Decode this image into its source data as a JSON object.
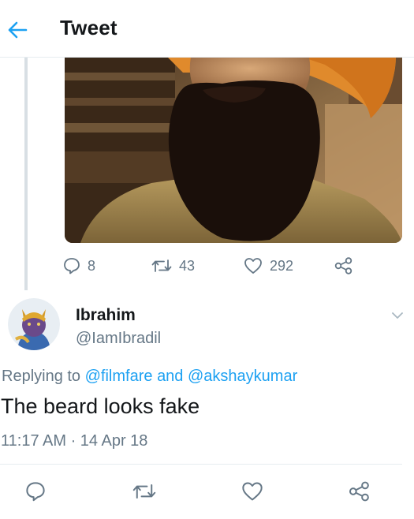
{
  "header": {
    "title": "Tweet",
    "back_icon": "arrow-left-icon",
    "accent_color": "#1da1f2"
  },
  "quoted_tweet": {
    "image": "photo of a man with a dark beard and orange turban",
    "actions": {
      "reply_count": "8",
      "retweet_count": "43",
      "like_count": "292",
      "share_icon": "share-icon"
    }
  },
  "reply_tweet": {
    "author_name": "Ibrahim",
    "author_handle": "@IamIbradil",
    "replying_label": "Replying to",
    "mention_1": "@filmfare",
    "and_label": "and",
    "mention_2": "@akshaykumar",
    "text": "The beard looks fake",
    "timestamp": "11:17 AM · 14 Apr 18",
    "menu_icon": "chevron-down-icon"
  },
  "bottom_actions": [
    "reply-icon",
    "retweet-icon",
    "like-icon",
    "share-icon"
  ],
  "colors": {
    "text_primary": "#14171a",
    "text_secondary": "#657786",
    "divider": "#e6ecf0"
  }
}
